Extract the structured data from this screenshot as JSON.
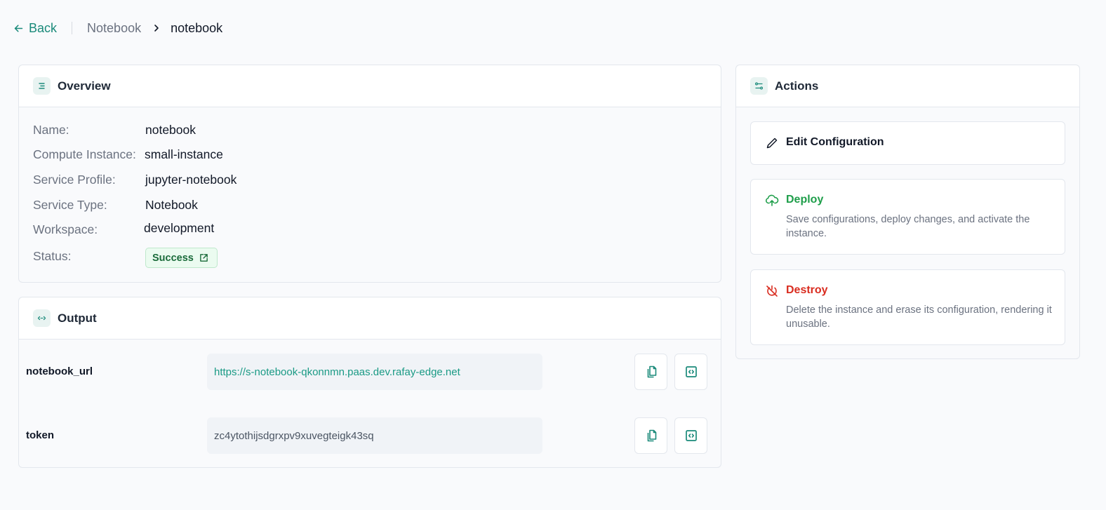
{
  "breadcrumb": {
    "back_label": "Back",
    "parent": "Notebook",
    "current": "notebook"
  },
  "overview": {
    "title": "Overview",
    "fields": [
      {
        "label": "Name:",
        "value": "notebook"
      },
      {
        "label": "Compute Instance:",
        "value": "small-instance"
      },
      {
        "label": "Service Profile:",
        "value": "jupyter-notebook"
      },
      {
        "label": "Service Type:",
        "value": "Notebook"
      },
      {
        "label": "Workspace:",
        "value": "development"
      },
      {
        "label": "Status:",
        "value": "Success"
      }
    ]
  },
  "output": {
    "title": "Output",
    "rows": [
      {
        "key": "notebook_url",
        "value": "https://s-notebook-qkonnmn.paas.dev.rafay-edge.net"
      },
      {
        "key": "token",
        "value": "zc4ytothijsdgrxpv9xuvegteigk43sq"
      }
    ]
  },
  "actions": {
    "title": "Actions",
    "edit": {
      "label": "Edit Configuration"
    },
    "deploy": {
      "label": "Deploy",
      "description": "Save configurations, deploy changes, and activate the instance.",
      "color": "#1e9e4a"
    },
    "destroy": {
      "label": "Destroy",
      "description": "Delete the instance and erase its configuration, rendering it unusable.",
      "color": "#d92d20"
    }
  },
  "colors": {
    "accent": "#1a8a7a",
    "success_text": "#1a6b3a",
    "success_bg": "#ebfbf0"
  }
}
